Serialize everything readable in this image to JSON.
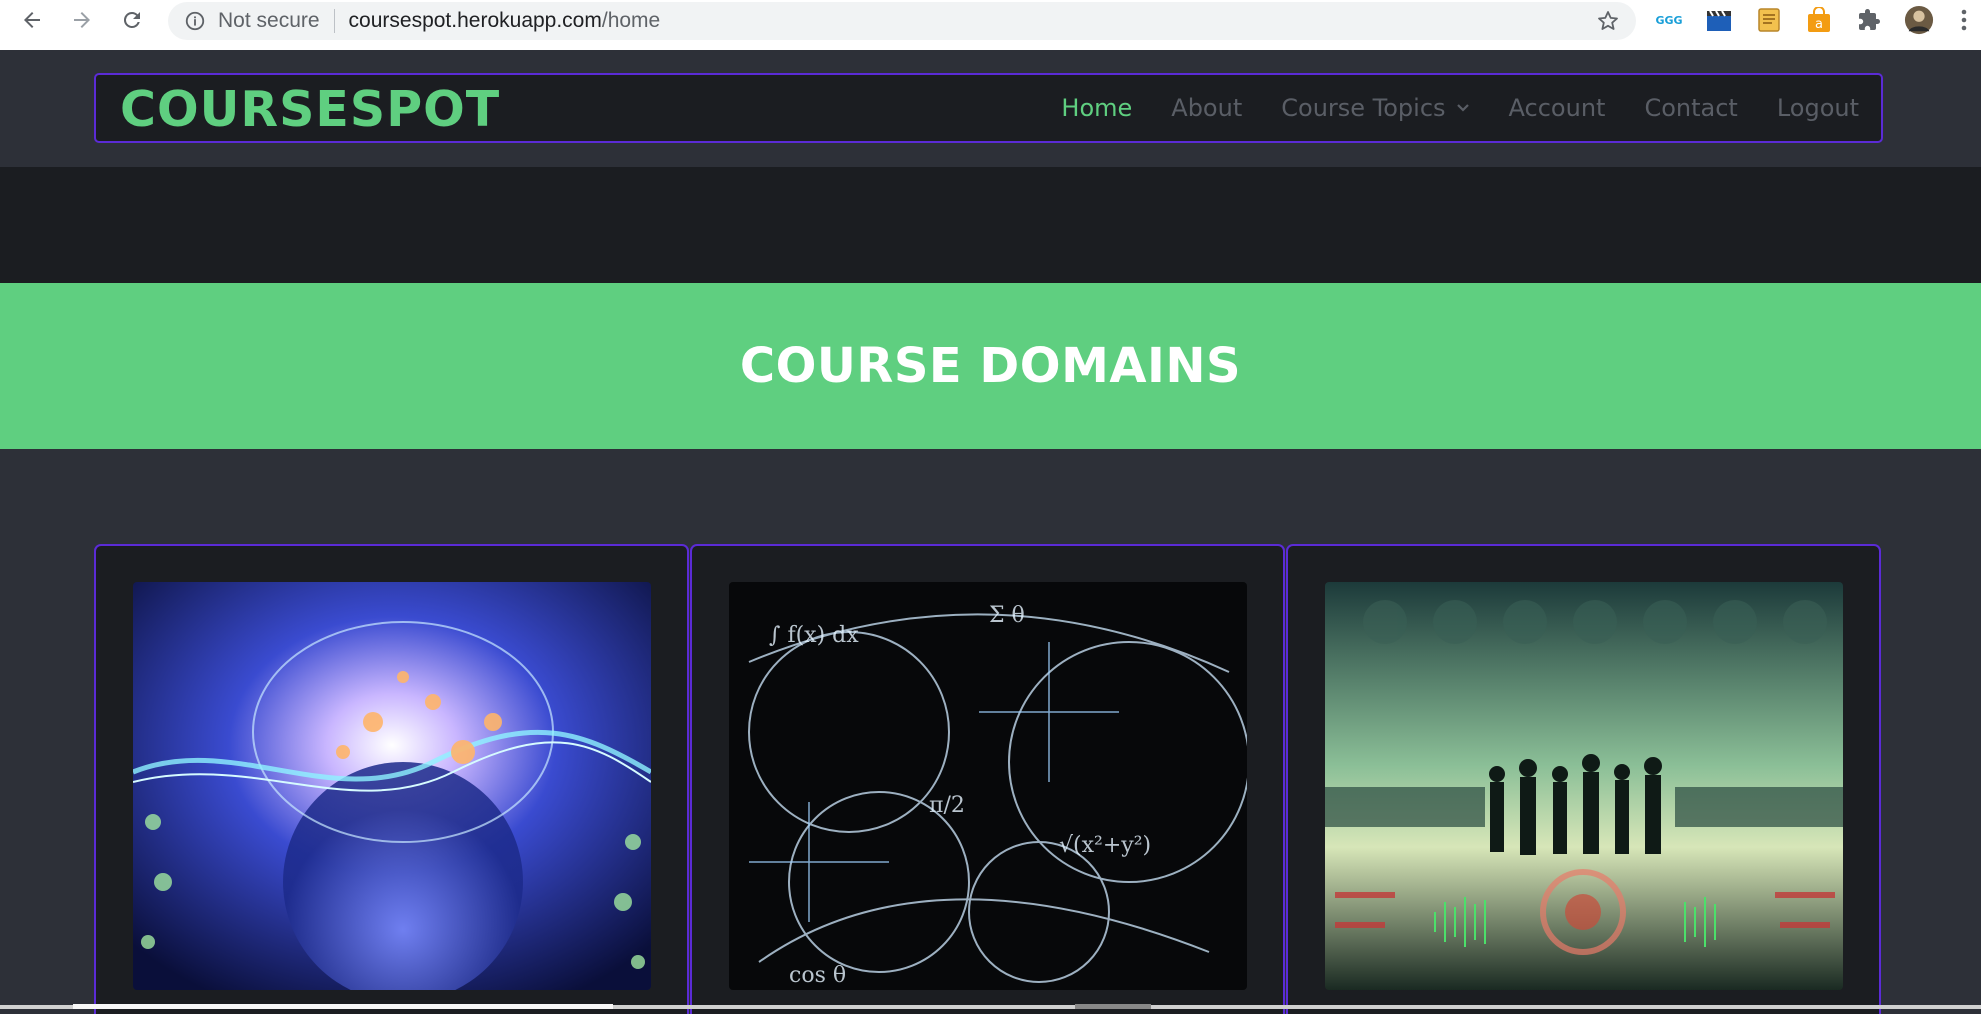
{
  "browser": {
    "security_label": "Not secure",
    "url_host": "coursespot.herokuapp.com",
    "url_path": "/home",
    "extensions": [
      "ggg-icon",
      "clapperboard-icon",
      "notes-icon",
      "shopping-bag-icon",
      "puzzle-icon",
      "profile-avatar"
    ]
  },
  "site": {
    "brand": "COURSESPOT",
    "nav": [
      {
        "label": "Home",
        "active": true
      },
      {
        "label": "About"
      },
      {
        "label": "Course Topics",
        "dropdown": true
      },
      {
        "label": "Account"
      },
      {
        "label": "Contact"
      },
      {
        "label": "Logout"
      }
    ]
  },
  "hero": {
    "title": "COURSE DOMAINS"
  },
  "colors": {
    "accent": "#5fcf80",
    "border": "#5b2bd6",
    "background": "#2d3038",
    "surface": "#1b1d21"
  },
  "cards": [
    {
      "image": "ai-brain-image"
    },
    {
      "image": "math-formulas-image"
    },
    {
      "image": "business-world-image"
    }
  ]
}
